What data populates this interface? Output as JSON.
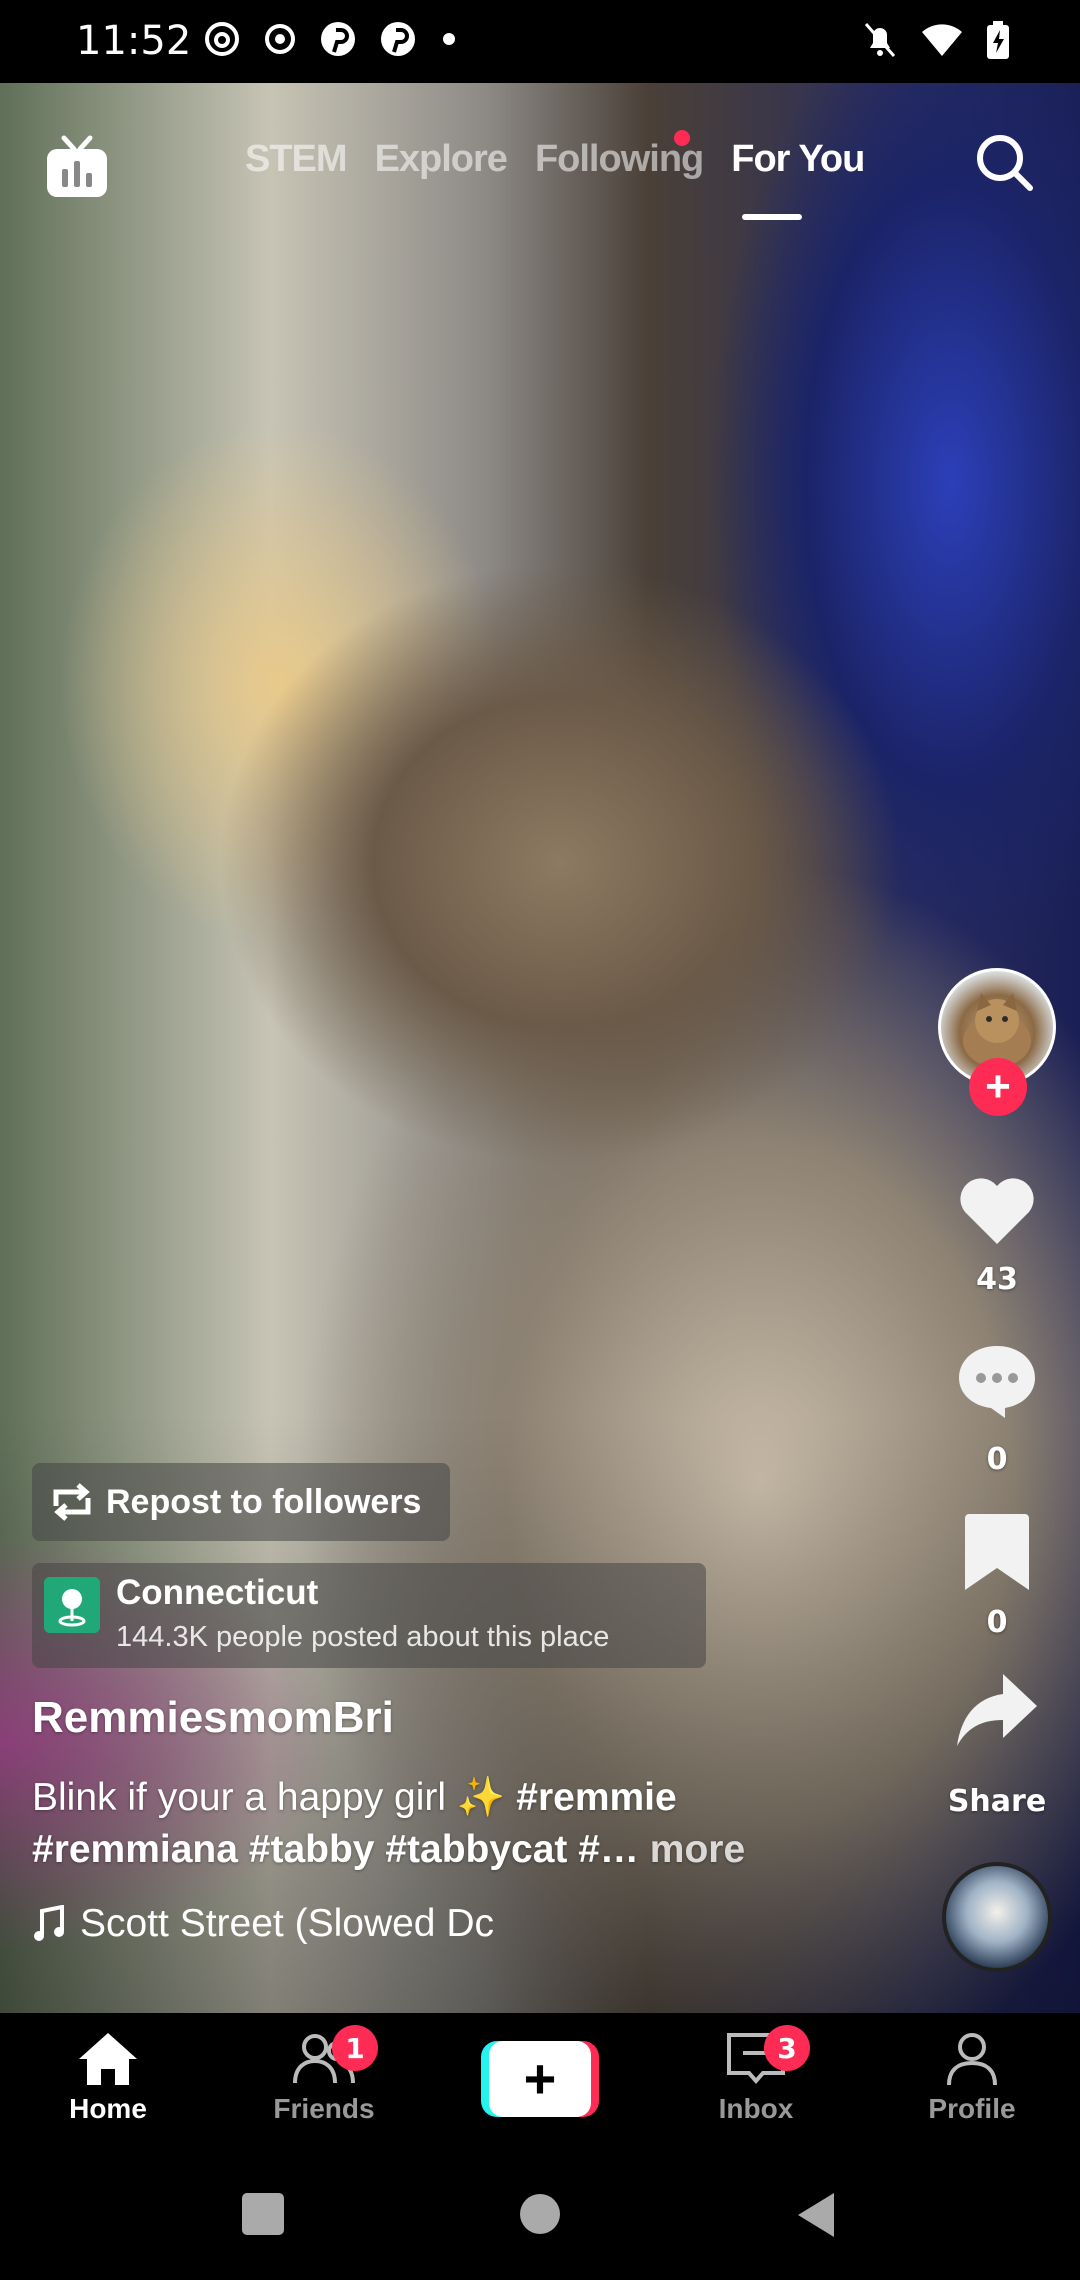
{
  "status_bar": {
    "time": "11:52",
    "left_icons": [
      "threads-icon",
      "record-icon",
      "pinterest-icon",
      "pinterest-icon",
      "dot-icon"
    ],
    "right_icons": [
      "mute-icon",
      "wifi-icon",
      "battery-charging-icon"
    ]
  },
  "top_tabs": {
    "items": [
      {
        "label": "STEM"
      },
      {
        "label": "Explore"
      },
      {
        "label": "Following"
      },
      {
        "label": "For You"
      }
    ],
    "active": "For You",
    "accent": "#fe2c55"
  },
  "rail": {
    "likes": "43",
    "comments": "0",
    "saves": "0",
    "share_label": "Share"
  },
  "post": {
    "repost_label": "Repost to followers",
    "location_name": "Connecticut",
    "location_sub": "144.3K people posted about this place",
    "username": "RemmiesmomBri",
    "caption_text": "Blink if your a happy girl ✨ ",
    "caption_tags": "#remmie #remmiana #tabby #tabbycat #…",
    "caption_more": "more",
    "sound": "Scott Street (Slowed Dc"
  },
  "bottom_nav": {
    "home": "Home",
    "friends": "Friends",
    "friends_badge": "1",
    "inbox": "Inbox",
    "inbox_badge": "3",
    "profile": "Profile"
  }
}
